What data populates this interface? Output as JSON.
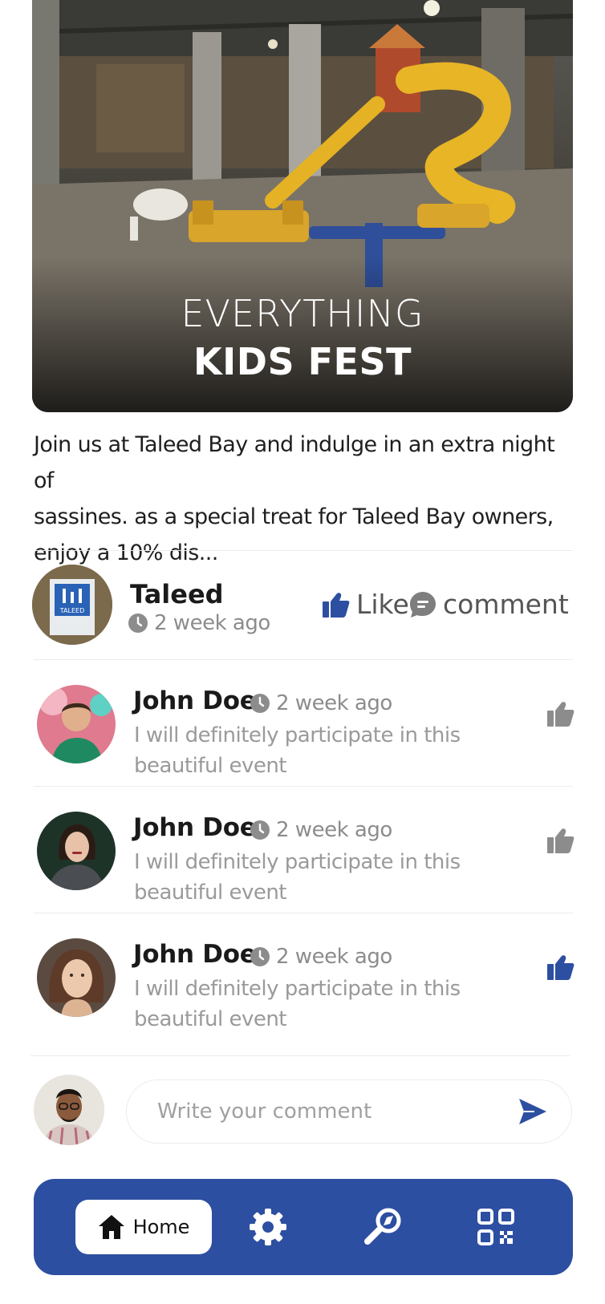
{
  "hero": {
    "title_line1": "EVERYTHING",
    "title_line2": "KIDS FEST"
  },
  "post": {
    "description_line1": "Join us at Taleed Bay and indulge in an extra night of",
    "description_line2": "sassines. as a  special treat for Taleed Bay owners,",
    "description_line3": "enjoy a 10% dis...",
    "author": "Taleed",
    "time": "2 week ago",
    "like_label": "Like",
    "comment_label": "comment",
    "avatar_text": "TALEED"
  },
  "comments": [
    {
      "name": "John Doe",
      "time": "2 week ago",
      "text_line1": "I will definitely participate in this",
      "text_line2": "beautiful event",
      "liked": false
    },
    {
      "name": "John Doe",
      "time": "2 week ago",
      "text_line1": "I will definitely participate in this",
      "text_line2": "beautiful event",
      "liked": false
    },
    {
      "name": "John Doe",
      "time": "2 week ago",
      "text_line1": "I will definitely participate in this",
      "text_line2": "beautiful event",
      "liked": true
    }
  ],
  "composer": {
    "placeholder": "Write your comment"
  },
  "nav": {
    "home_label": "Home",
    "icons": [
      "home-icon",
      "settings-icon",
      "explore-icon",
      "qr-code-icon"
    ]
  },
  "colors": {
    "brand_blue": "#2d4fa1",
    "muted_text": "#9a9a9a",
    "icon_gray": "#8c8c8c",
    "like_active": "#2d4fa1"
  }
}
